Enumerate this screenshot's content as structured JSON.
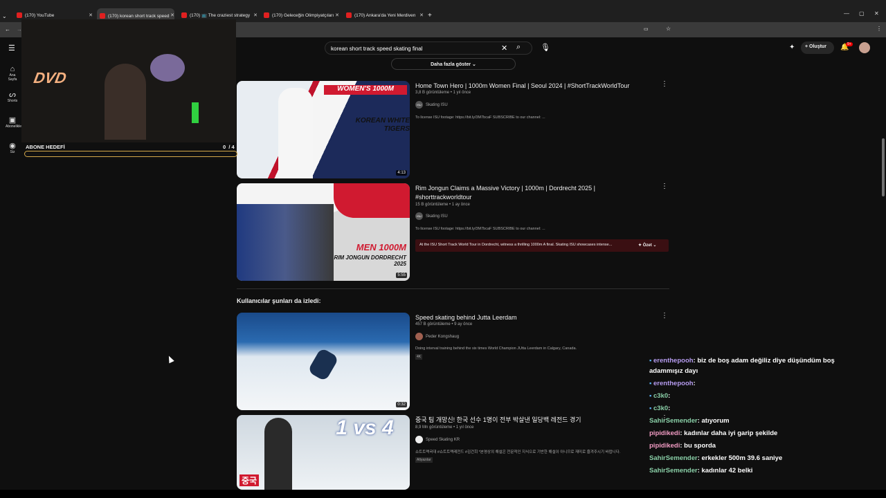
{
  "tabs": [
    {
      "label": "(170) YouTube",
      "active": false
    },
    {
      "label": "(170) korean short track speed",
      "active": true
    },
    {
      "label": "(170) 📺 The craziest strategy",
      "active": false
    },
    {
      "label": "(170) Geleceğin Olimpiyatçıları",
      "active": false
    },
    {
      "label": "(170) Ankara'da Yeni Merdiven",
      "active": false
    }
  ],
  "search": {
    "query": "korean short track speed skating final",
    "more_label": "Daha fazla göster"
  },
  "header": {
    "create_label": "Oluştur",
    "notif_count": "9+"
  },
  "sidebar": [
    {
      "label": "Ana Sayfa"
    },
    {
      "label": "Shorts"
    },
    {
      "label": "Abonelikler"
    },
    {
      "label": "Siz"
    }
  ],
  "overlay": {
    "dvd": "DVD",
    "goal_label": "ABONE HEDEFİ",
    "goal_value": "0",
    "goal_target": "/ 4",
    "goal_progress": 0
  },
  "videos": [
    {
      "title": "Home Town Hero | 1000m Women Final | Seoul 2024 | #ShortTrackWorldTour",
      "meta": "3,8 B görüntüleme • 1 yıl önce",
      "channel": "Skating ISU",
      "desc": "To license ISU footage: https://bit.ly/3M7bcaF SUBSCRIBE to our channel: ...",
      "duration": "4:13",
      "thumb_title": "WOMEN'S 1000M",
      "thumb_sub": "KOREAN WHITE TIGERS"
    },
    {
      "title": "Rim Jongun Claims a Massive Victory | 1000m | Dordrecht 2025 | #shorttrackworldtour",
      "meta": "15 B görüntüleme • 1 ay önce",
      "channel": "Skating ISU",
      "desc": "To license ISU footage: https://bit.ly/3M7bcaF SUBSCRIBE to our channel: ...",
      "duration": "5:55",
      "summary": "At the ISU Short Track World Tour in Dordrecht, witness a thrilling 1000m A final. Skating ISU showcases intense...",
      "summary_btn": "Özet",
      "thumb_title": "MEN 1000M",
      "thumb_sub": "RIM JONGUN DORDRECHT 2025"
    }
  ],
  "section_title": "Kullanıcılar şunları da izledi:",
  "related": [
    {
      "title": "Speed skating behind Jutta Leerdam",
      "meta": "457 B görüntüleme • 9 ay önce",
      "channel": "Peder Kongshaug",
      "desc": "Doing interval training behind the six times World Champion JUtta Leerdam in Calgary, Canada.",
      "badge": "4K",
      "duration": "0:32"
    },
    {
      "title": "중국 팀 개망신! 한국 선수 1명이 전부 박살낸 일당백 레전드 경기",
      "meta": "8,9 Mn görüntüleme • 1 yıl önce",
      "channel": "Speed Skating KR",
      "desc": "쇼트트랙국대 #쇼트트랙레전드 #김건희 *본영상의 해설은 전문적인 지식으로 기반한 해설이 아니므로 재미로 즐겨주시기 바랍니다.",
      "badge": "Altyazılar",
      "thumb_big": "1 vs 4",
      "thumb_corner": "중국"
    }
  ],
  "chat": [
    {
      "user": "erenthepooh",
      "msg": ": biz de boş adam değiliz diye düşündüm boş"
    },
    {
      "user": "",
      "msg": "adammışız dayı"
    },
    {
      "user": "erenthepooh",
      "msg": ":"
    },
    {
      "user": "c3k0",
      "msg": ":"
    },
    {
      "user": "c3k0",
      "msg": ":"
    },
    {
      "user": "SahirSemender",
      "msg": ": atıyorum"
    },
    {
      "user": "pipidikedi",
      "msg": ": kadınlar daha iyi garip şekilde"
    },
    {
      "user": "pipidikedi",
      "msg": ": bu sporda"
    },
    {
      "user": "SahirSemender",
      "msg": ": erkekler 500m 39.6 saniye"
    },
    {
      "user": "SahirSemender",
      "msg": ": kadınlar 42 belki"
    }
  ]
}
